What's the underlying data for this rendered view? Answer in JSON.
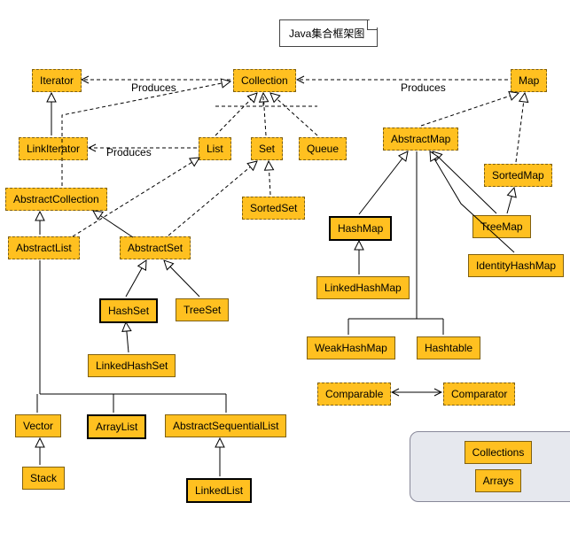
{
  "title": "Java集合框架图",
  "nodes": {
    "Iterator": "Iterator",
    "Collection": "Collection",
    "Map": "Map",
    "LinkIterator": "LinkIterator",
    "List": "List",
    "Set": "Set",
    "Queue": "Queue",
    "AbstractMap": "AbstractMap",
    "SortedMap": "SortedMap",
    "AbstractCollection": "AbstractCollection",
    "SortedSet": "SortedSet",
    "HashMap": "HashMap",
    "TreeMap": "TreeMap",
    "IdentityHashMap": "IdentityHashMap",
    "AbstractList": "AbstractList",
    "AbstractSet": "AbstractSet",
    "LinkedHashMap": "LinkedHashMap",
    "HashSet": "HashSet",
    "TreeSet": "TreeSet",
    "WeakHashMap": "WeakHashMap",
    "Hashtable": "Hashtable",
    "LinkedHashSet": "LinkedHashSet",
    "Comparable": "Comparable",
    "Comparator": "Comparator",
    "Vector": "Vector",
    "ArrayList": "ArrayList",
    "AbstractSequentialList": "AbstractSequentialList",
    "Stack": "Stack",
    "LinkedList": "LinkedList",
    "Collections": "Collections",
    "Arrays": "Arrays"
  },
  "edge_labels": {
    "produces1": "Produces",
    "produces2": "Produces",
    "produces3": "Produces"
  },
  "chart_data": {
    "type": "diagram",
    "title": "Java集合框架图",
    "nodes": [
      {
        "id": "Iterator",
        "style": "dashed"
      },
      {
        "id": "Collection",
        "style": "dashed"
      },
      {
        "id": "Map",
        "style": "dashed"
      },
      {
        "id": "LinkIterator",
        "style": "dashed"
      },
      {
        "id": "List",
        "style": "dashed"
      },
      {
        "id": "Set",
        "style": "dashed"
      },
      {
        "id": "Queue",
        "style": "dashed"
      },
      {
        "id": "AbstractMap",
        "style": "dashed"
      },
      {
        "id": "SortedMap",
        "style": "dashed"
      },
      {
        "id": "AbstractCollection",
        "style": "dashed"
      },
      {
        "id": "SortedSet",
        "style": "dashed"
      },
      {
        "id": "HashMap",
        "style": "bold"
      },
      {
        "id": "TreeMap",
        "style": "solid"
      },
      {
        "id": "IdentityHashMap",
        "style": "solid"
      },
      {
        "id": "AbstractList",
        "style": "dashed"
      },
      {
        "id": "AbstractSet",
        "style": "dashed"
      },
      {
        "id": "LinkedHashMap",
        "style": "solid"
      },
      {
        "id": "HashSet",
        "style": "bold"
      },
      {
        "id": "TreeSet",
        "style": "solid"
      },
      {
        "id": "WeakHashMap",
        "style": "solid"
      },
      {
        "id": "Hashtable",
        "style": "solid"
      },
      {
        "id": "LinkedHashSet",
        "style": "solid"
      },
      {
        "id": "Comparable",
        "style": "dashed"
      },
      {
        "id": "Comparator",
        "style": "dashed"
      },
      {
        "id": "Vector",
        "style": "solid"
      },
      {
        "id": "ArrayList",
        "style": "bold"
      },
      {
        "id": "AbstractSequentialList",
        "style": "solid"
      },
      {
        "id": "Stack",
        "style": "solid"
      },
      {
        "id": "LinkedList",
        "style": "bold"
      },
      {
        "id": "Collections",
        "style": "solid"
      },
      {
        "id": "Arrays",
        "style": "solid"
      }
    ],
    "edges": [
      {
        "from": "Collection",
        "to": "Iterator",
        "type": "produces",
        "style": "dashed-arrow"
      },
      {
        "from": "Map",
        "to": "Collection",
        "type": "produces",
        "style": "dashed-arrow"
      },
      {
        "from": "List",
        "to": "LinkIterator",
        "type": "produces",
        "style": "dashed-arrow"
      },
      {
        "from": "LinkIterator",
        "to": "Iterator",
        "type": "extends",
        "style": "hollow-tri"
      },
      {
        "from": "List",
        "to": "Collection",
        "type": "extends",
        "style": "dashed-hollow-tri"
      },
      {
        "from": "Set",
        "to": "Collection",
        "type": "extends",
        "style": "dashed-hollow-tri"
      },
      {
        "from": "Queue",
        "to": "Collection",
        "type": "extends",
        "style": "dashed-hollow-tri"
      },
      {
        "from": "AbstractCollection",
        "to": "Collection",
        "type": "implements",
        "style": "dashed-hollow-tri"
      },
      {
        "from": "SortedSet",
        "to": "Set",
        "type": "extends",
        "style": "dashed-hollow-tri"
      },
      {
        "from": "AbstractList",
        "to": "AbstractCollection",
        "type": "extends",
        "style": "hollow-tri"
      },
      {
        "from": "AbstractList",
        "to": "List",
        "type": "implements",
        "style": "dashed-hollow-tri"
      },
      {
        "from": "AbstractSet",
        "to": "AbstractCollection",
        "type": "extends",
        "style": "hollow-tri"
      },
      {
        "from": "AbstractSet",
        "to": "Set",
        "type": "implements",
        "style": "dashed-hollow-tri"
      },
      {
        "from": "HashSet",
        "to": "AbstractSet",
        "type": "extends",
        "style": "hollow-tri"
      },
      {
        "from": "TreeSet",
        "to": "AbstractSet",
        "type": "extends",
        "style": "hollow-tri"
      },
      {
        "from": "LinkedHashSet",
        "to": "HashSet",
        "type": "extends",
        "style": "hollow-tri"
      },
      {
        "from": "Vector",
        "to": "AbstractList",
        "type": "extends",
        "style": "hollow-tri"
      },
      {
        "from": "ArrayList",
        "to": "AbstractList",
        "type": "extends",
        "style": "hollow-tri"
      },
      {
        "from": "AbstractSequentialList",
        "to": "AbstractList",
        "type": "extends",
        "style": "hollow-tri"
      },
      {
        "from": "Stack",
        "to": "Vector",
        "type": "extends",
        "style": "hollow-tri"
      },
      {
        "from": "LinkedList",
        "to": "AbstractSequentialList",
        "type": "extends",
        "style": "hollow-tri"
      },
      {
        "from": "AbstractMap",
        "to": "Map",
        "type": "implements",
        "style": "dashed-hollow-tri"
      },
      {
        "from": "SortedMap",
        "to": "Map",
        "type": "extends",
        "style": "dashed-hollow-tri"
      },
      {
        "from": "HashMap",
        "to": "AbstractMap",
        "type": "extends",
        "style": "hollow-tri"
      },
      {
        "from": "TreeMap",
        "to": "AbstractMap",
        "type": "extends",
        "style": "hollow-tri"
      },
      {
        "from": "TreeMap",
        "to": "SortedMap",
        "type": "implements",
        "style": "hollow-tri"
      },
      {
        "from": "IdentityHashMap",
        "to": "AbstractMap",
        "type": "extends",
        "style": "hollow-tri"
      },
      {
        "from": "LinkedHashMap",
        "to": "HashMap",
        "type": "extends",
        "style": "hollow-tri"
      },
      {
        "from": "WeakHashMap",
        "to": "AbstractMap",
        "type": "extends",
        "style": "hollow-tri"
      },
      {
        "from": "Hashtable",
        "to": "AbstractMap",
        "type": "extends",
        "style": "hollow-tri"
      },
      {
        "from": "Comparable",
        "to": "Comparator",
        "type": "bidir",
        "style": "solid-double-arrow"
      }
    ],
    "legend": [
      "Collections",
      "Arrays"
    ]
  }
}
